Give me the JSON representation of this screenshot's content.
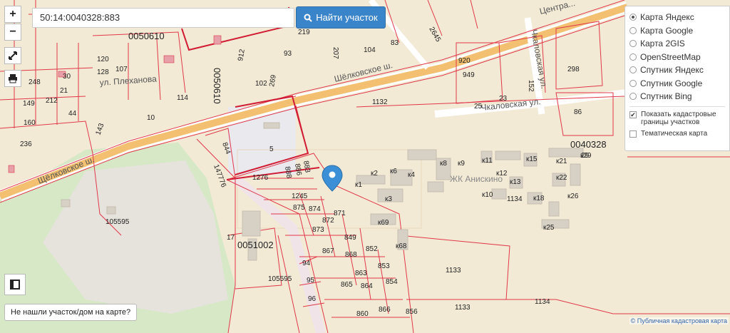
{
  "controls": {
    "zoom_in": "+",
    "zoom_out": "−",
    "search_value": "50:14:0040328:883",
    "search_button": "Найти участок",
    "not_found": "Не нашли участок/дом на карте?",
    "icons": [
      "fullscreen-icon",
      "print-icon",
      "layers-toggle-icon",
      "search-icon"
    ]
  },
  "layers": {
    "base": [
      {
        "label": "Карта Яндекс",
        "selected": true
      },
      {
        "label": "Карта Google",
        "selected": false
      },
      {
        "label": "Карта 2GIS",
        "selected": false
      },
      {
        "label": "OpenStreetMap",
        "selected": false
      },
      {
        "label": "Спутник Яндекс",
        "selected": false
      },
      {
        "label": "Спутник Google",
        "selected": false
      },
      {
        "label": "Спутник Bing",
        "selected": false
      }
    ],
    "overlays": [
      {
        "label": "Показать кадастровые границы участков",
        "checked": true
      },
      {
        "label": "Тематическая карта",
        "checked": false
      }
    ]
  },
  "map": {
    "copyright": "© Публичная кадастровая карта",
    "streets": {
      "shchelkovskoe": "Шёлковское ш.",
      "shchelkovskoe_left": "Щёлковское ш.",
      "chkalovskaya": "Чкаловская ул.",
      "chkalovskaya_v": "Чкаловская ул.",
      "plekhanova": "ул. Плеханова",
      "tsentr": "Центра..."
    },
    "quarters": {
      "q1": "0050610",
      "q2": "0050610",
      "q3": "0051002",
      "q4": "0040328"
    },
    "complex": "ЖК Анискино",
    "parcels": {
      "p1132": "1132",
      "p1133": "1133",
      "p1134": "1134",
      "p1134b": "1134",
      "p1133b": "1133",
      "p105595": "105595",
      "p105595b": "105595",
      "p147776": "147776",
      "p1276": "1276",
      "p1245": "1245",
      "p5": "5",
      "p844": "844",
      "p17": "17",
      "p114": "114",
      "p236": "236",
      "p160": "160",
      "p10": "10",
      "p29": "29",
      "p871": "871",
      "p872": "872",
      "p873": "873",
      "p874": "874",
      "p875": "875",
      "p849": "849",
      "p852": "852",
      "p853": "853",
      "p854": "854",
      "p856": "856",
      "p860": "860",
      "p863": "863",
      "p864": "864",
      "p865": "865",
      "p866": "866",
      "p867": "867",
      "p868": "868",
      "p888": "888",
      "p886": "886",
      "p883": "883",
      "p94": "94",
      "p95": "95",
      "p96": "96",
      "p920": "920",
      "p949": "949",
      "p25": "25",
      "p23": "23",
      "p86": "86",
      "p104": "104",
      "p102": "102",
      "p83": "83",
      "p93": "93",
      "p207": "207",
      "p219": "219",
      "p120": "120",
      "p128": "128",
      "p107": "107",
      "p143": "143",
      "p149": "149",
      "p212": "212",
      "p21": "21",
      "p44": "44",
      "p30": "30",
      "p248": "248",
      "p152": "152",
      "p298": "298",
      "p2645": "2645",
      "p912": "912",
      "p269": "269"
    },
    "buildings": [
      "к1",
      "к2",
      "к3",
      "к4",
      "к6",
      "к8",
      "к9",
      "к10",
      "к11",
      "к12",
      "к13",
      "к15",
      "к18",
      "к21",
      "к22",
      "к25",
      "к26",
      "к29",
      "к68",
      "к69"
    ]
  }
}
